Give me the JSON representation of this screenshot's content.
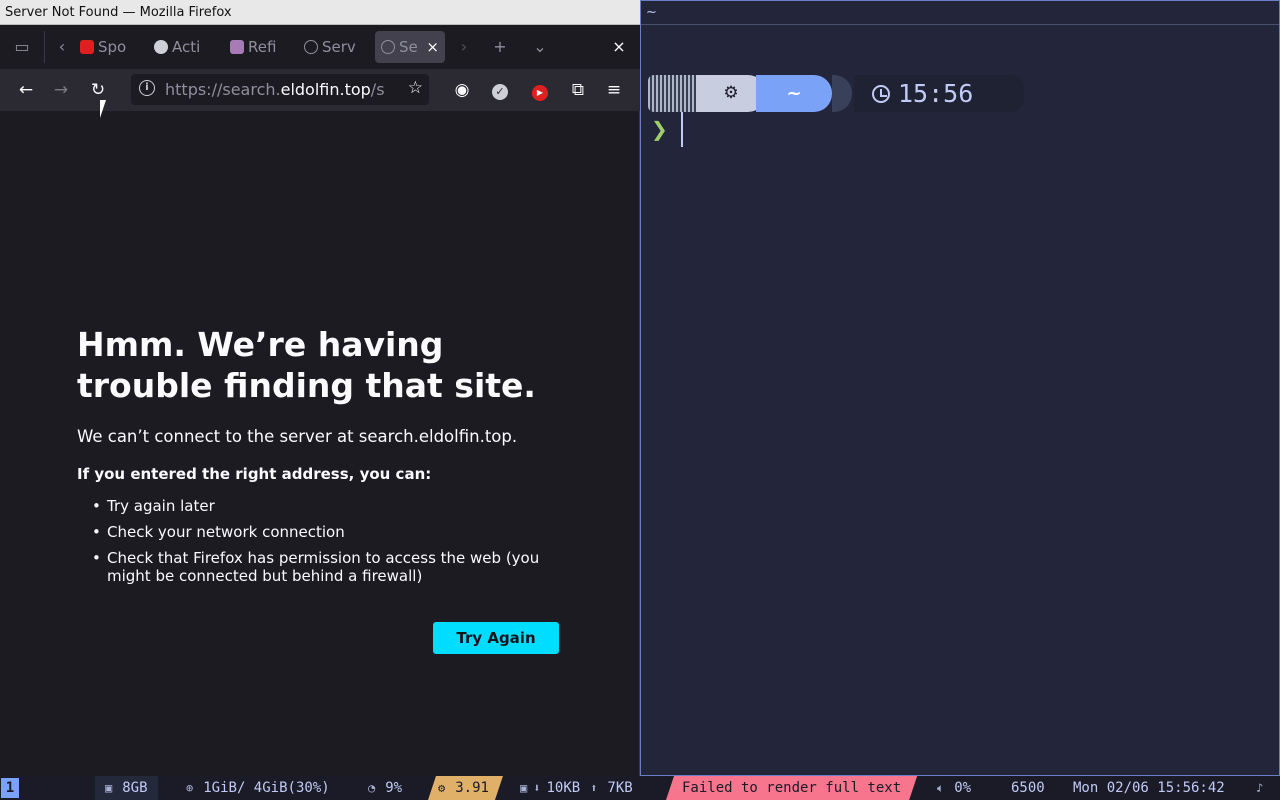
{
  "firefox": {
    "window_title": "Server Not Found — Mozilla Firefox",
    "tabs": [
      {
        "label": "Spo",
        "favicon_color": "#e02020",
        "favicon": "youtube-icon"
      },
      {
        "label": "Acti",
        "favicon_color": "#cfcfd8",
        "favicon": "activity-icon"
      },
      {
        "label": "Refi",
        "favicon_color": "#a77bb5",
        "favicon": "refine-icon"
      },
      {
        "label": "Serv",
        "favicon_color": "#8f8f9d",
        "favicon": "info-icon"
      },
      {
        "label": "Se",
        "favicon_color": "#8f8f9d",
        "favicon": "info-icon",
        "active": true
      }
    ],
    "url": {
      "prefix": "https://search.",
      "host": "eldolfin.top",
      "suffix": "/s"
    },
    "error": {
      "title": "Hmm. We’re having trouble finding that site.",
      "description": "We can’t connect to the server at search.eldolfin.top.",
      "subtitle": "If you entered the right address, you can:",
      "suggestions": [
        "Try again later",
        "Check your network connection",
        "Check that Firefox has permission to access the web (you might be connected but behind a firewall)"
      ],
      "button_label": "Try Again"
    }
  },
  "terminal": {
    "title": "~",
    "os_icon": "gear-icon",
    "dir": "~",
    "time": "15:56",
    "prompt_char": "❯"
  },
  "statusbar": {
    "workspace": "1",
    "disk": "8GB",
    "memory": "1GiB/ 4GiB(30%)",
    "cpu": "9%",
    "load": "3.91",
    "net_down": "10KB",
    "net_up": "7KB",
    "error": "Failed to render full text",
    "volume": "0%",
    "brightness": "6500",
    "datetime": "Mon 02/06 15:56:42",
    "colors": {
      "accent": "#7aa2f7",
      "load_bg": "#e0af68",
      "error_bg": "#f7768e"
    }
  }
}
